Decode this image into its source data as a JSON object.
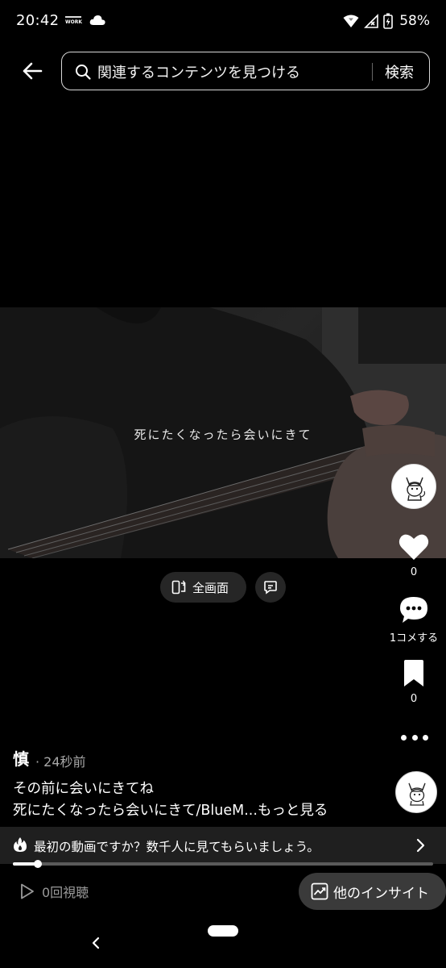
{
  "status_bar": {
    "time": "20:42",
    "work_badge": "WORK",
    "battery": "58%",
    "icons": [
      "cloud-icon",
      "wifi-icon",
      "no-signal-icon",
      "battery-charging-icon"
    ]
  },
  "search": {
    "placeholder": "関連するコンテンツを見つける",
    "submit_label": "検索"
  },
  "video": {
    "caption": "死にたくなったら会いにきて"
  },
  "controls": {
    "fullscreen_label": "全画面"
  },
  "actions": {
    "likes": "0",
    "comments": "1コメする",
    "bookmarks": "0"
  },
  "post": {
    "author": "慎",
    "time": "· 24秒前",
    "caption_line1": "その前に会いにきてね",
    "caption_line2": "死にたくなったら会いにきて/BlueM...",
    "see_more": "もっと見る"
  },
  "promo": {
    "text": "最初の動画ですか？数千人に見てもらいましょう。"
  },
  "playback": {
    "progress": 0.06
  },
  "footer": {
    "views": "0回視聴",
    "insights_label": "他のインサイト"
  },
  "colors": {
    "background": "#000000",
    "pill": "#262626",
    "banner": "#1f1f1f",
    "muted_text": "#a8a8a8"
  }
}
